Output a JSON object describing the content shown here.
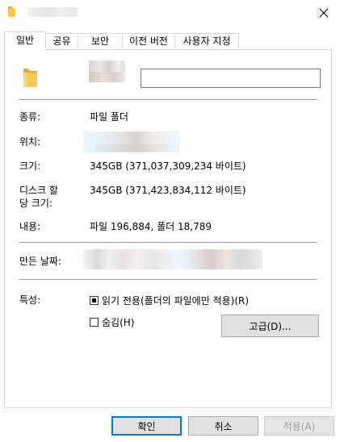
{
  "window": {
    "close_icon": "close-icon",
    "folder_icon": "folder-icon"
  },
  "tabs": [
    {
      "label": "일반"
    },
    {
      "label": "공유"
    },
    {
      "label": "보안"
    },
    {
      "label": "이전 버전"
    },
    {
      "label": "사용자 지정"
    }
  ],
  "general": {
    "name_value": "",
    "type_label": "종류:",
    "type_value": "파일 폴더",
    "location_label": "위치:",
    "size_label": "크기:",
    "size_value": "345GB (371,037,309,234 바이트)",
    "disk_size_label_1": "디스크 할",
    "disk_size_label_2": "당 크기:",
    "disk_size_value": "345GB (371,423,834,112 바이트)",
    "contains_label": "내용:",
    "contains_value": "파일 196,884, 폴더 18,789",
    "created_label": "만든 날짜:",
    "attributes_label": "특성:",
    "readonly_label": "읽기 전용(폴더의 파일에만 적용)(R)",
    "hidden_label": "숨김(H)",
    "advanced_button": "고급(D)..."
  },
  "footer": {
    "ok": "확인",
    "cancel": "취소",
    "apply": "적용(A)"
  },
  "colors": {
    "accent": "#0078d7",
    "folder": "#f5c85a",
    "button_bg": "#e1e1e1"
  }
}
